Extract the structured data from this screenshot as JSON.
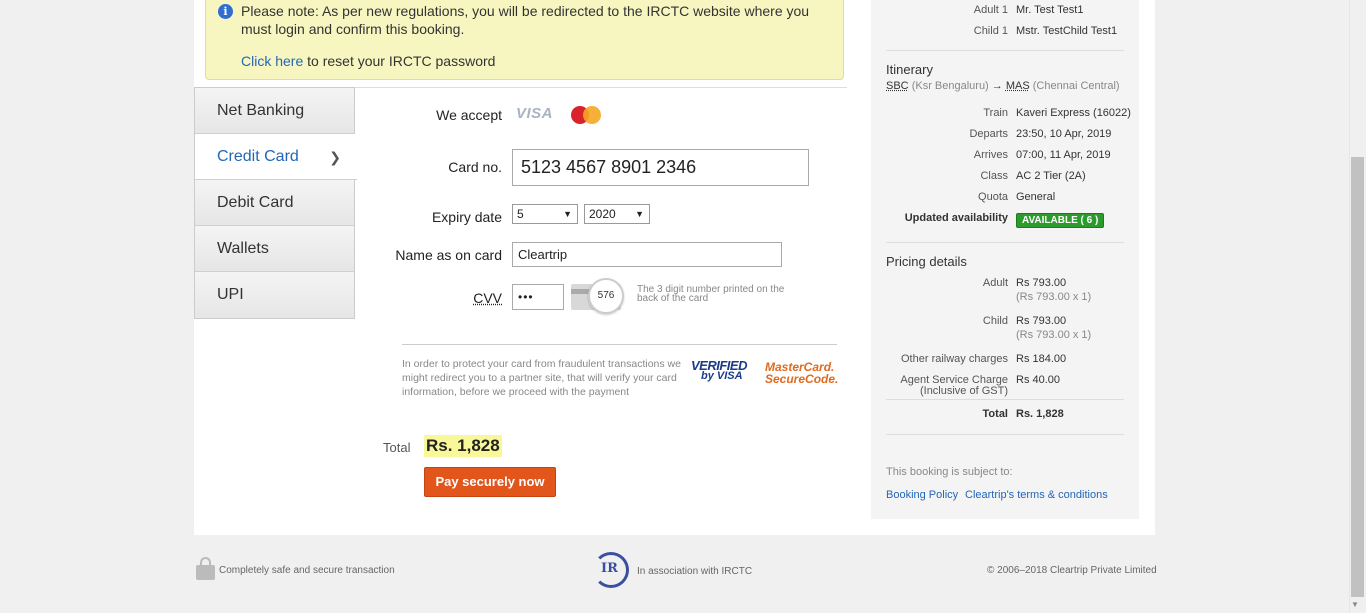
{
  "notice": {
    "text": "Please note: As per new regulations, you will be redirected to the IRCTC website where you must login and confirm this booking.",
    "link": "Click here",
    "link_suffix": " to reset your IRCTC password"
  },
  "payment_tabs": [
    {
      "label": "Net Banking",
      "active": false
    },
    {
      "label": "Credit Card",
      "active": true
    },
    {
      "label": "Debit Card",
      "active": false
    },
    {
      "label": "Wallets",
      "active": false
    },
    {
      "label": "UPI",
      "active": false
    }
  ],
  "form": {
    "we_accept_label": "We accept",
    "visa_label": "VISA",
    "card_no_label": "Card no.",
    "card_no_value": "5123 4567 8901 2346",
    "expiry_label": "Expiry date",
    "expiry_month": "5",
    "expiry_year": "2020",
    "name_label": "Name as on card",
    "name_value": "Cleartrip",
    "cvv_label": "CVV",
    "cvv_value": "•••",
    "cvv_sample": "576",
    "cvv_hint": "The 3 digit number printed on the back of the card",
    "protect_text": "In order to protect your card from fraudulent transactions we might redirect you to a partner site, that will verify your card information, before we proceed with the payment",
    "vbv_line1": "VERIFIED",
    "vbv_line2": "by VISA",
    "mc_line1": "MasterCard.",
    "mc_line2": "SecureCode.",
    "total_label": "Total",
    "total_value": "Rs. 1,828",
    "pay_button": "Pay securely now"
  },
  "sidebar": {
    "travellers": [
      {
        "key": "Adult 1",
        "value": "Mr. Test Test1"
      },
      {
        "key": "Child 1",
        "value": "Mstr. TestChild Test1"
      }
    ],
    "itinerary_title": "Itinerary",
    "route": {
      "from_code": "SBC",
      "from_name": "(Ksr Bengaluru)",
      "arrow": "→",
      "to_code": "MAS",
      "to_name": "(Chennai Central)"
    },
    "details": [
      {
        "key": "Train",
        "value": "Kaveri Express (16022)"
      },
      {
        "key": "Departs",
        "value": "23:50, 10 Apr, 2019"
      },
      {
        "key": "Arrives",
        "value": "07:00, 11 Apr, 2019"
      },
      {
        "key": "Class",
        "value": "AC 2 Tier (2A)"
      },
      {
        "key": "Quota",
        "value": "General"
      }
    ],
    "availability_label": "Updated availability",
    "availability_value": "AVAILABLE ( 6 )",
    "pricing_title": "Pricing details",
    "pricing": [
      {
        "key": "Adult",
        "value": "Rs 793.00",
        "sub": "(Rs 793.00 x 1)"
      },
      {
        "key": "Child",
        "value": "Rs 793.00",
        "sub": "(Rs 793.00 x 1)"
      },
      {
        "key": "Other railway charges",
        "value": "Rs 184.00",
        "sub": ""
      },
      {
        "key": "Agent Service Charge",
        "key2": "(Inclusive of GST)",
        "value": "Rs 40.00",
        "sub": ""
      }
    ],
    "total_label": "Total",
    "total_value": "Rs. 1,828",
    "subject_text": "This booking is subject to:",
    "booking_policy": "Booking Policy",
    "terms": "Cleartrip's terms & conditions"
  },
  "footer": {
    "secure_text": "Completely safe and secure transaction",
    "association_text": "In association with IRCTC",
    "copyright": "© 2006–2018 Cleartrip Private Limited"
  },
  "colors": {
    "accent_blue": "#2366b8",
    "pay_button": "#e2561c",
    "available_badge": "#2d9a2d",
    "notice_bg": "#f7f6c0"
  }
}
